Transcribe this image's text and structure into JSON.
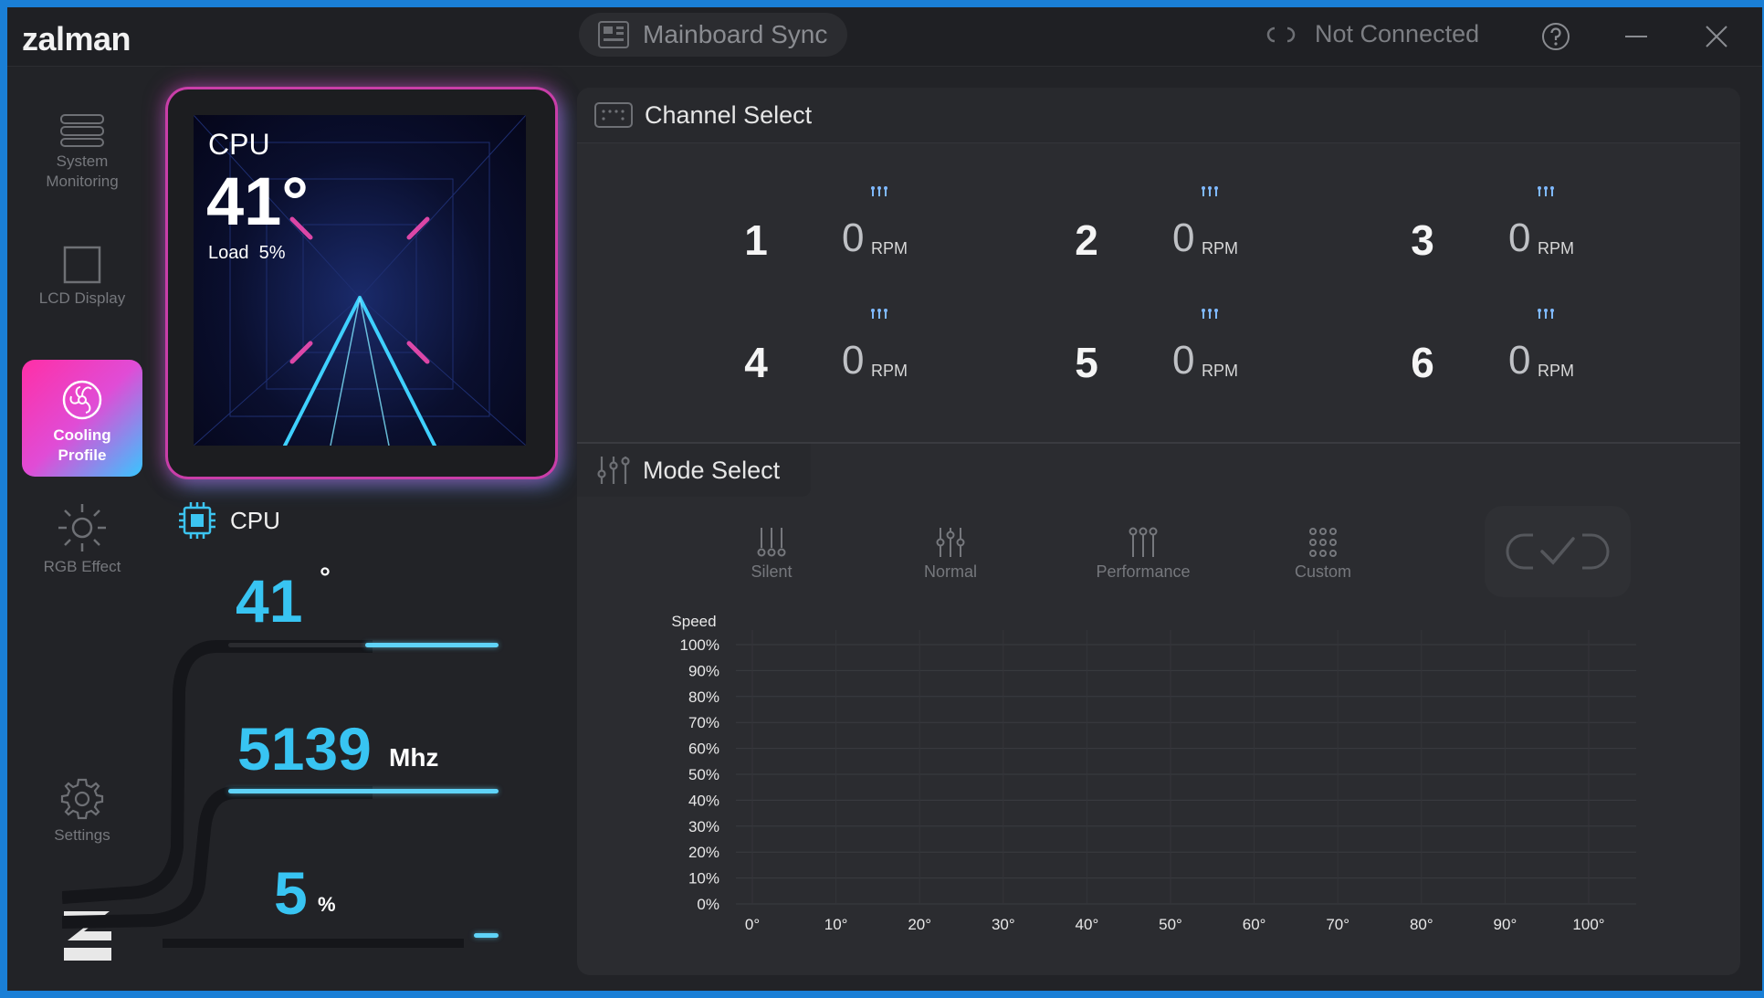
{
  "app": {
    "logo": "zalman",
    "sync_label": "Mainboard Sync",
    "connection_status": "Not Connected"
  },
  "sidebar": {
    "items": [
      {
        "label_line1": "System",
        "label_line2": "Monitoring",
        "icon": "system-monitoring-icon"
      },
      {
        "label_line1": "LCD Display",
        "label_line2": "",
        "icon": "lcd-display-icon"
      },
      {
        "label_line1": "Cooling",
        "label_line2": "Profile",
        "icon": "cooling-profile-icon",
        "active": true
      },
      {
        "label_line1": "RGB Effect",
        "label_line2": "",
        "icon": "rgb-effect-icon"
      },
      {
        "label_line1": "Settings",
        "label_line2": "",
        "icon": "settings-icon"
      }
    ]
  },
  "lcd_preview": {
    "label": "CPU",
    "temp": "41°",
    "load_label": "Load",
    "load_value": "5%"
  },
  "cpu_stats": {
    "title": "CPU",
    "temp_value": "41",
    "temp_unit": "°",
    "temp_fraction": 0.41,
    "clock_value": "5139",
    "clock_unit": "Mhz",
    "load_value": "5",
    "load_unit": "%",
    "load_fraction": 0.05
  },
  "channel_select": {
    "title": "Channel Select",
    "rpm_unit": "RPM",
    "channels": [
      {
        "num": "1",
        "rpm": "0"
      },
      {
        "num": "2",
        "rpm": "0"
      },
      {
        "num": "3",
        "rpm": "0"
      },
      {
        "num": "4",
        "rpm": "0"
      },
      {
        "num": "5",
        "rpm": "0"
      },
      {
        "num": "6",
        "rpm": "0"
      }
    ]
  },
  "mode_select": {
    "title": "Mode Select",
    "modes": [
      "Silent",
      "Normal",
      "Performance",
      "Custom"
    ]
  },
  "chart_data": {
    "type": "line",
    "title": "",
    "ylabel": "Speed",
    "xlabel": "",
    "y_ticks": [
      "100%",
      "90%",
      "80%",
      "70%",
      "60%",
      "50%",
      "40%",
      "30%",
      "20%",
      "10%",
      "0%"
    ],
    "x_ticks": [
      "0°",
      "10°",
      "20°",
      "30°",
      "40°",
      "50°",
      "60°",
      "70°",
      "80°",
      "90°",
      "100°"
    ],
    "xlim": [
      0,
      100
    ],
    "ylim": [
      0,
      100
    ],
    "grid": true,
    "series": []
  }
}
